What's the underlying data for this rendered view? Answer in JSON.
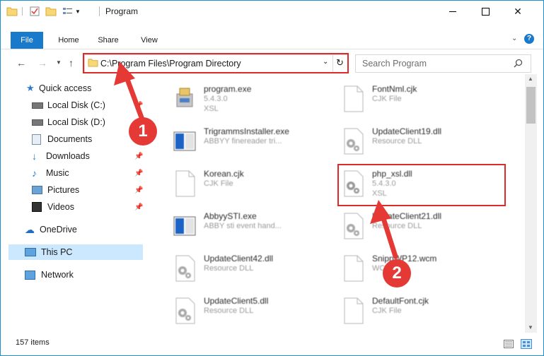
{
  "window": {
    "title": "Program"
  },
  "ribbon": {
    "tabs": [
      "File",
      "Home",
      "Share",
      "View"
    ]
  },
  "address": {
    "path": "C:\\Program Files\\Program Directory"
  },
  "search": {
    "placeholder": "Search Program"
  },
  "nav": {
    "items": [
      {
        "label": "Quick access",
        "icon": "star-icon"
      },
      {
        "label": "Local Disk (C:)",
        "icon": "drive-icon",
        "pinned": true
      },
      {
        "label": "Local Disk (D:)",
        "icon": "drive-icon"
      },
      {
        "label": "Documents",
        "icon": "documents-icon",
        "pinned": true
      },
      {
        "label": "Downloads",
        "icon": "downloads-icon",
        "pinned": true
      },
      {
        "label": "Music",
        "icon": "music-icon",
        "pinned": true
      },
      {
        "label": "Pictures",
        "icon": "pictures-icon",
        "pinned": true
      },
      {
        "label": "Videos",
        "icon": "videos-icon",
        "pinned": true
      },
      {
        "label": "OneDrive",
        "icon": "cloud-icon"
      },
      {
        "label": "This PC",
        "icon": "computer-icon",
        "selected": true
      },
      {
        "label": "Network",
        "icon": "network-icon"
      }
    ]
  },
  "files": [
    {
      "name": "program.exe",
      "line2": "5.4.3.0",
      "line3": "XSL",
      "icon": "program-icon"
    },
    {
      "name": "FontNml.cjk",
      "line2": "CJK File",
      "line3": "",
      "icon": "blank-file-icon"
    },
    {
      "name": "TrigrammsInstaller.exe",
      "line2": "ABBYY finereader tri...",
      "line3": "",
      "icon": "installer-icon"
    },
    {
      "name": "UpdateClient19.dll",
      "line2": "Resource DLL",
      "line3": "",
      "icon": "gear-file-icon"
    },
    {
      "name": "Korean.cjk",
      "line2": "CJK File",
      "line3": "",
      "icon": "blank-file-icon"
    },
    {
      "name": "php_xsl.dll",
      "line2": "5.4.3.0",
      "line3": "XSL",
      "icon": "gear-file-icon"
    },
    {
      "name": "AbbyySTI.exe",
      "line2": "ABBY sti event hand...",
      "line3": "",
      "icon": "installer-icon"
    },
    {
      "name": "UpdateClient21.dll",
      "line2": "Resource DLL",
      "line3": "",
      "icon": "gear-file-icon"
    },
    {
      "name": "UpdateClient42.dll",
      "line2": "Resource DLL",
      "line3": "",
      "icon": "gear-file-icon"
    },
    {
      "name": "SnippWP12.wcm",
      "line2": "WCM File",
      "line3": "",
      "icon": "blank-file-icon"
    },
    {
      "name": "UpdateClient5.dll",
      "line2": "Resource DLL",
      "line3": "",
      "icon": "gear-file-icon"
    },
    {
      "name": "DefaultFont.cjk",
      "line2": "CJK File",
      "line3": "",
      "icon": "blank-file-icon"
    }
  ],
  "status": {
    "item_count": "157 items"
  },
  "annotations": {
    "step1": "1",
    "step2": "2"
  },
  "colors": {
    "accent": "#1979ca",
    "highlight": "#e02a2a",
    "selected_bg": "#cce8ff"
  }
}
